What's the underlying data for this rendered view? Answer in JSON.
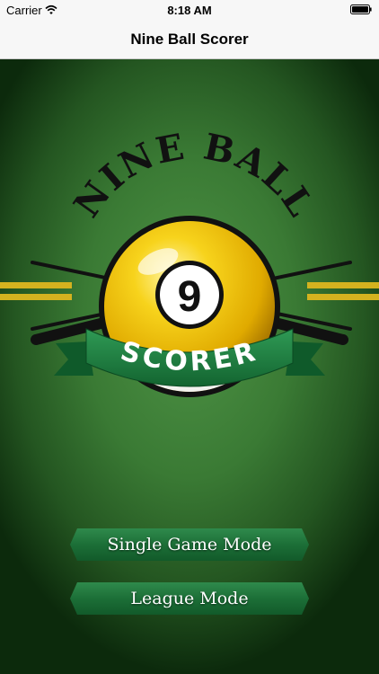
{
  "status_bar": {
    "carrier": "Carrier",
    "time": "8:18 AM"
  },
  "nav": {
    "title": "Nine Ball Scorer"
  },
  "logo": {
    "top_text": "NINE BALL",
    "ball_number": "9",
    "banner_text": "SCORER"
  },
  "buttons": {
    "single_game": "Single Game Mode",
    "league": "League Mode"
  },
  "colors": {
    "felt": "#3a7a34",
    "ball_yellow": "#f2c300",
    "banner_green": "#1c7a3f",
    "stripe_yellow": "#d4b21f"
  },
  "icons": [
    "wifi-icon",
    "battery-icon",
    "cue-stick-icon"
  ]
}
